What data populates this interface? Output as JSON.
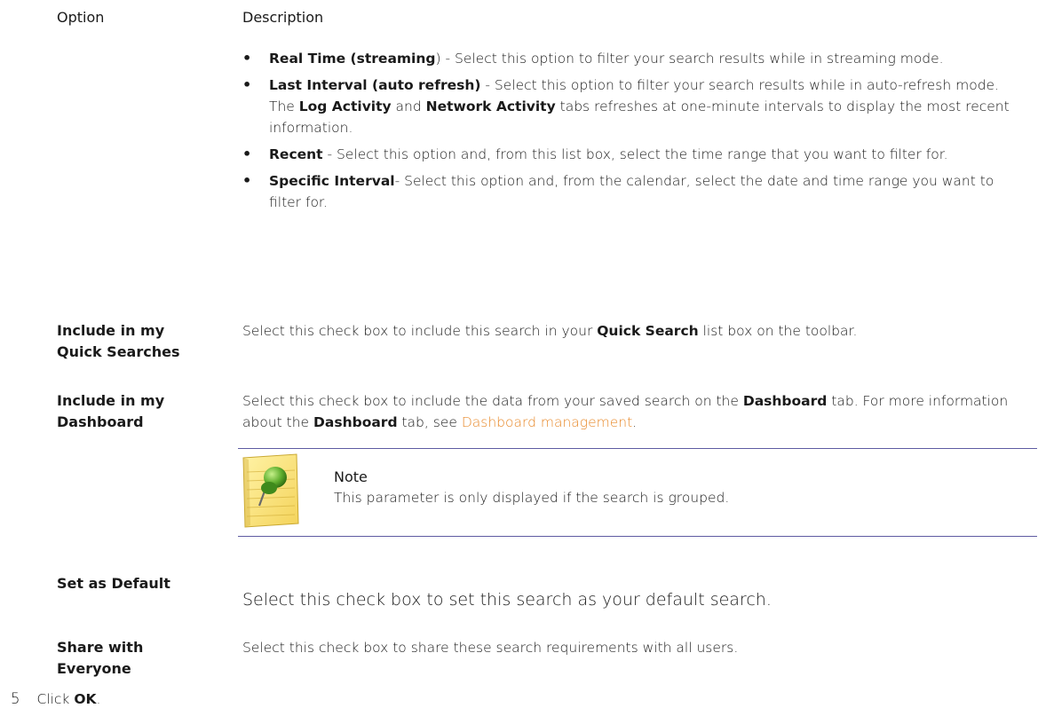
{
  "table": {
    "header_option": "Option",
    "header_description": "Description",
    "time_range_bullets": [
      {
        "bold": "Real Time (streaming",
        "rest": ") - Select this option to filter your search results while in streaming mode."
      },
      {
        "bold": "Last Interval (auto refresh)",
        "rest_1": " - Select this option to filter your search results while in auto-refresh mode. The ",
        "bold_2": "Log Activity",
        "rest_2": " and ",
        "bold_3": "Network Activity",
        "rest_3": " tabs refreshes at one-minute intervals to display the most recent information."
      },
      {
        "bold": "Recent",
        "rest": " - Select this option and, from this list box, select the time range that you want to filter for."
      },
      {
        "bold": "Specific Interval",
        "rest": "- Select this option and, from the calendar, select the date and time range you want to filter for."
      }
    ],
    "rows": [
      {
        "label": "Include in my Quick Searches",
        "desc_1": "Select this check box to include this search in your ",
        "desc_bold": "Quick Search",
        "desc_2": " list box on the toolbar."
      },
      {
        "label": "Include in my Dashboard",
        "desc_1": "Select this check box to include the data from your saved search on the ",
        "desc_bold": "Dashboard",
        "desc_2": " tab. For more information about the ",
        "desc_bold_2": "Dashboard",
        "desc_3": " tab, see ",
        "link": "Dashboard management",
        "desc_4": "."
      },
      {
        "label": "Set as Default",
        "desc": "Select this check box to set this search as your default search."
      },
      {
        "label": "Share with Everyone",
        "desc": "Select this check box to share these search requirements with all users."
      }
    ],
    "note": {
      "title": "Note",
      "text": "This parameter is only displayed if the search is grouped."
    }
  },
  "step": {
    "number": "5",
    "text": "Click ",
    "bold": "OK",
    "end": "."
  }
}
